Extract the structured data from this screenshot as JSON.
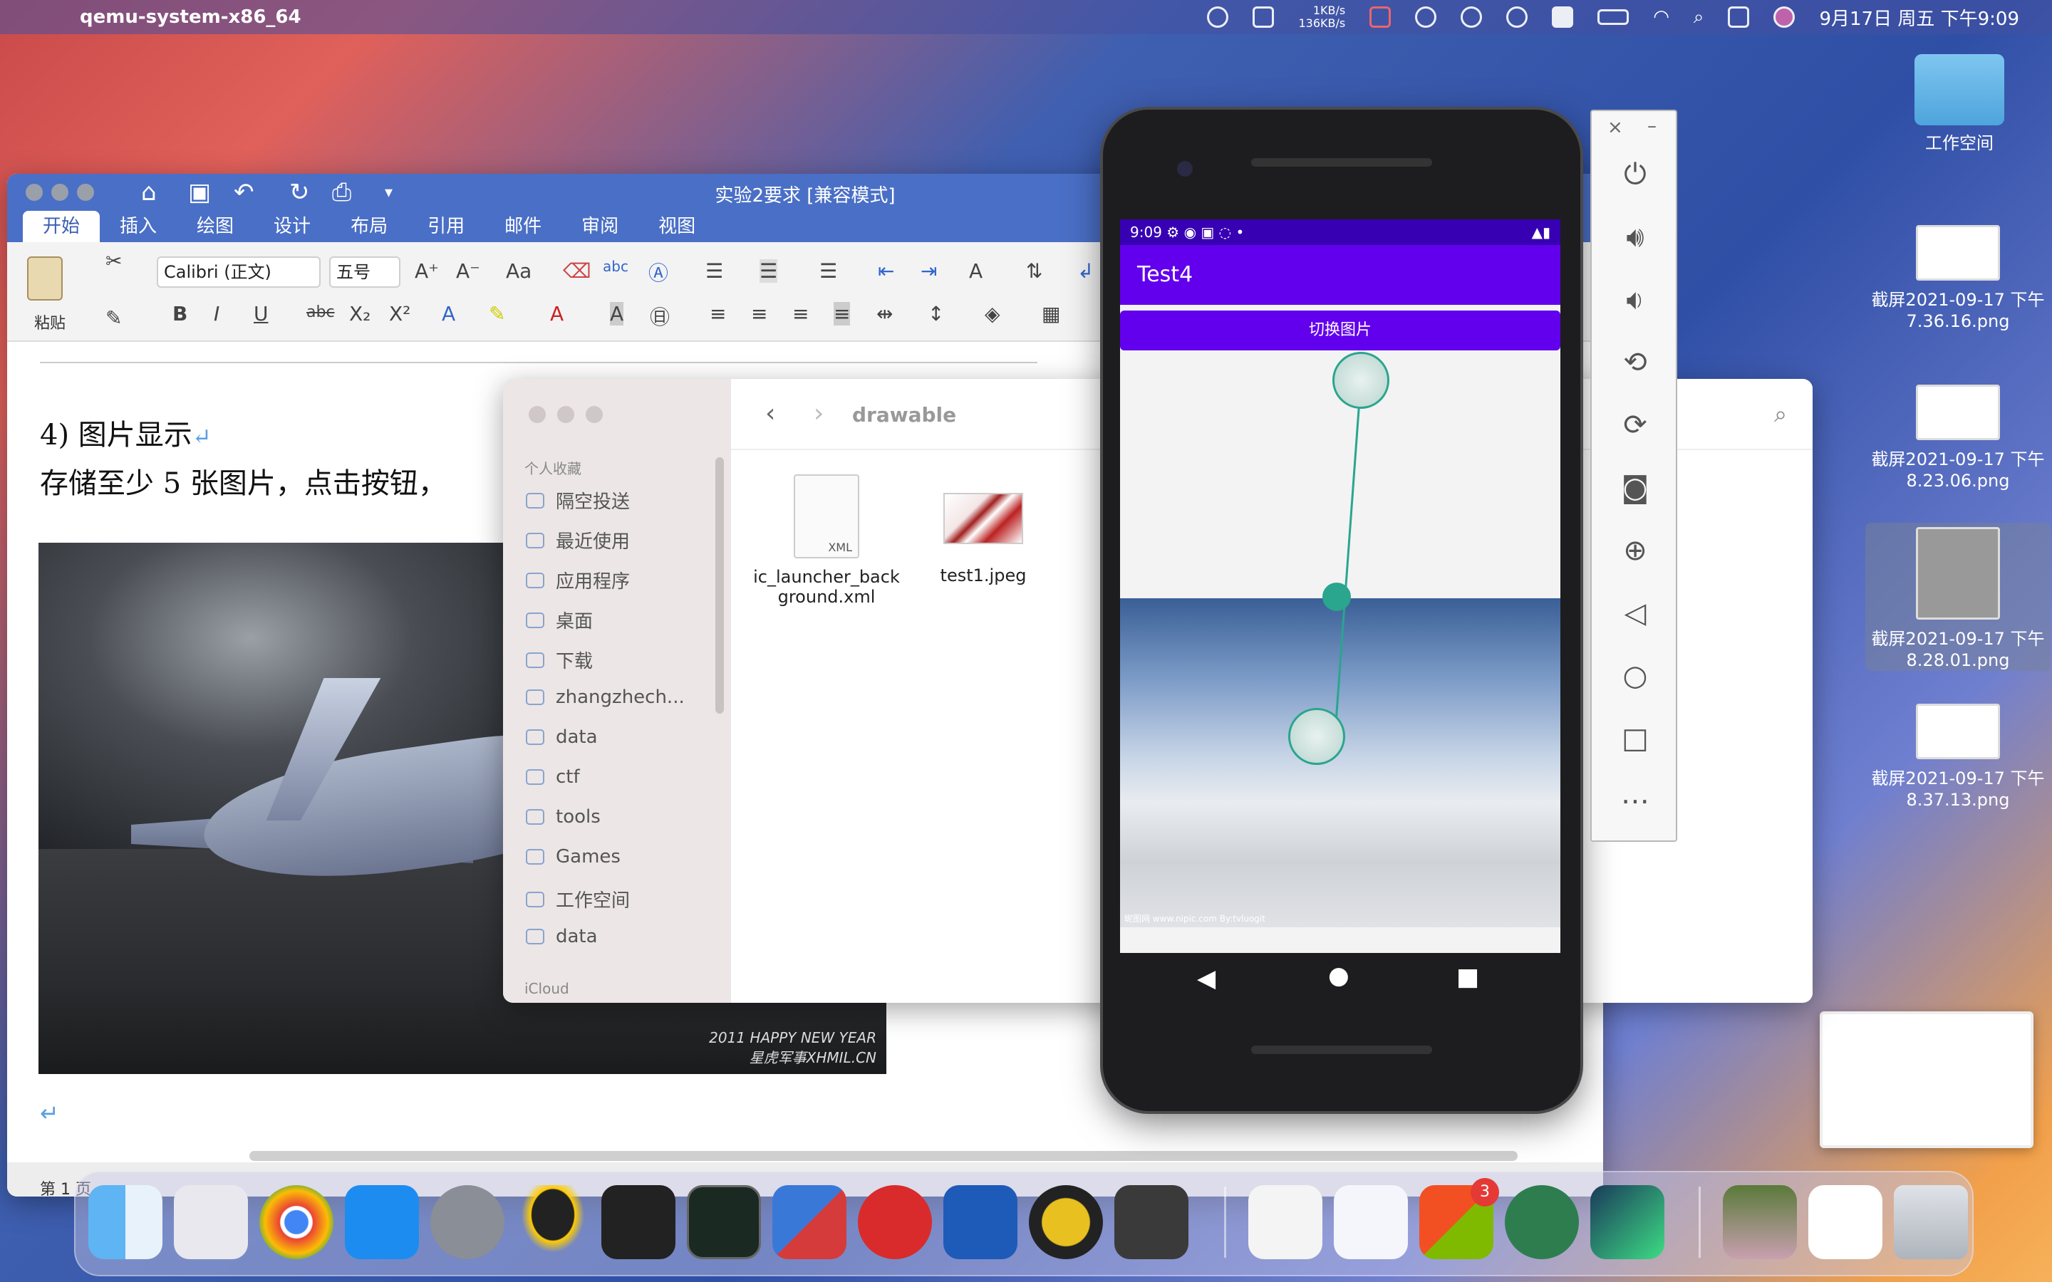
{
  "menubar": {
    "app_name": "qemu-system-x86_64",
    "net_up": "1KB/s",
    "net_down": "136KB/s",
    "clock": "9月17日 周五 下午9:09"
  },
  "word": {
    "title": "实验2要求 [兼容模式]",
    "tabs": [
      "开始",
      "插入",
      "绘图",
      "设计",
      "布局",
      "引用",
      "邮件",
      "审阅",
      "视图"
    ],
    "font": "Calibri (正文)",
    "size": "五号",
    "paste": "粘贴",
    "heading": "4) 图片显示",
    "paragraph": "存储至少 5 张图片，点击按钮，",
    "status": "第 1 页",
    "jet_caption": "2011 HAPPY NEW YEAR\n星虎军事XHMIL.CN"
  },
  "finder": {
    "folder": "drawable",
    "section_favorites": "个人收藏",
    "section_icloud": "iCloud",
    "sidebar": [
      "隔空投送",
      "最近使用",
      "应用程序",
      "桌面",
      "下载",
      "zhangzhech...",
      "data",
      "ctf",
      "tools",
      "Games",
      "工作空间",
      "data"
    ],
    "files": [
      {
        "name": "ic_launcher_background.xml",
        "tag": "XML"
      },
      {
        "name": "test1.jpeg"
      }
    ]
  },
  "phone": {
    "time": "9:09",
    "app_title": "Test4",
    "button_label": "切换图片",
    "image_caption": "昵图网 www.nipic.com   By:tvluogit"
  },
  "emulator": {
    "buttons": [
      "power-icon",
      "volume-up-icon",
      "volume-down-icon",
      "rotate-left-icon",
      "rotate-right-icon",
      "camera-icon",
      "zoom-icon",
      "back-icon",
      "home-icon",
      "overview-icon",
      "more-icon"
    ]
  },
  "desktop": {
    "workspace": "工作空间",
    "screenshots": [
      "截屏2021-09-17 下午7.36.16.png",
      "截屏2021-09-17 下午8.23.06.png",
      "截屏2021-09-17 下午8.28.01.png",
      "截屏2021-09-17 下午8.37.13.png"
    ]
  },
  "dock": {
    "badge_count": "3"
  }
}
